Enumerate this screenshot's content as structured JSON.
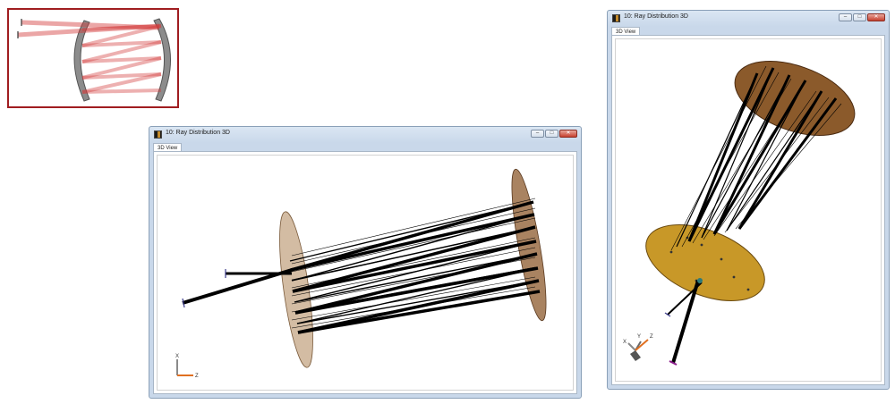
{
  "preview": {
    "border_color": "#a01d20",
    "ray_color": "#d23a3a",
    "mirror_color": "#8c8c8c"
  },
  "windows": [
    {
      "title": "10: Ray Distribution 3D",
      "tab_label": "3D View",
      "controls": {
        "minimize": "–",
        "maximize": "□",
        "close": "✕"
      },
      "axes": {
        "x": "X",
        "z": "Z"
      }
    },
    {
      "title": "10: Ray Distribution 3D",
      "tab_label": "3D View",
      "controls": {
        "minimize": "–",
        "maximize": "□",
        "close": "✕"
      },
      "axes": {
        "x": "X",
        "y": "Y",
        "z": "Z"
      }
    }
  ],
  "colors": {
    "mirror_a": "#c8ab8c",
    "mirror_b": "#9a6d45",
    "disk_top": "#8b5a2b",
    "disk_bottom": "#c89828",
    "rays": "#000000"
  }
}
